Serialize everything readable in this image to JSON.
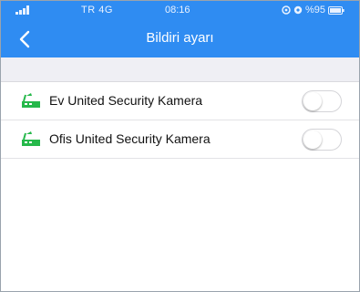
{
  "status_bar": {
    "carrier": "TR 4G",
    "time": "08:16",
    "battery": "%95",
    "icons": [
      "signal-icon",
      "alarm-icon",
      "focus-icon",
      "battery-icon"
    ]
  },
  "nav": {
    "title": "Bildiri ayarı",
    "back_icon": "chevron-left-icon"
  },
  "colors": {
    "header": "#2f8cf2",
    "section_background": "#efeff4",
    "camera_icon": "#25b84a"
  },
  "devices": [
    {
      "label": "Ev United Security Kamera",
      "icon": "camera-device-icon",
      "notifications_enabled": false
    },
    {
      "label": "Ofis United Security Kamera",
      "icon": "camera-device-icon",
      "notifications_enabled": false
    }
  ]
}
